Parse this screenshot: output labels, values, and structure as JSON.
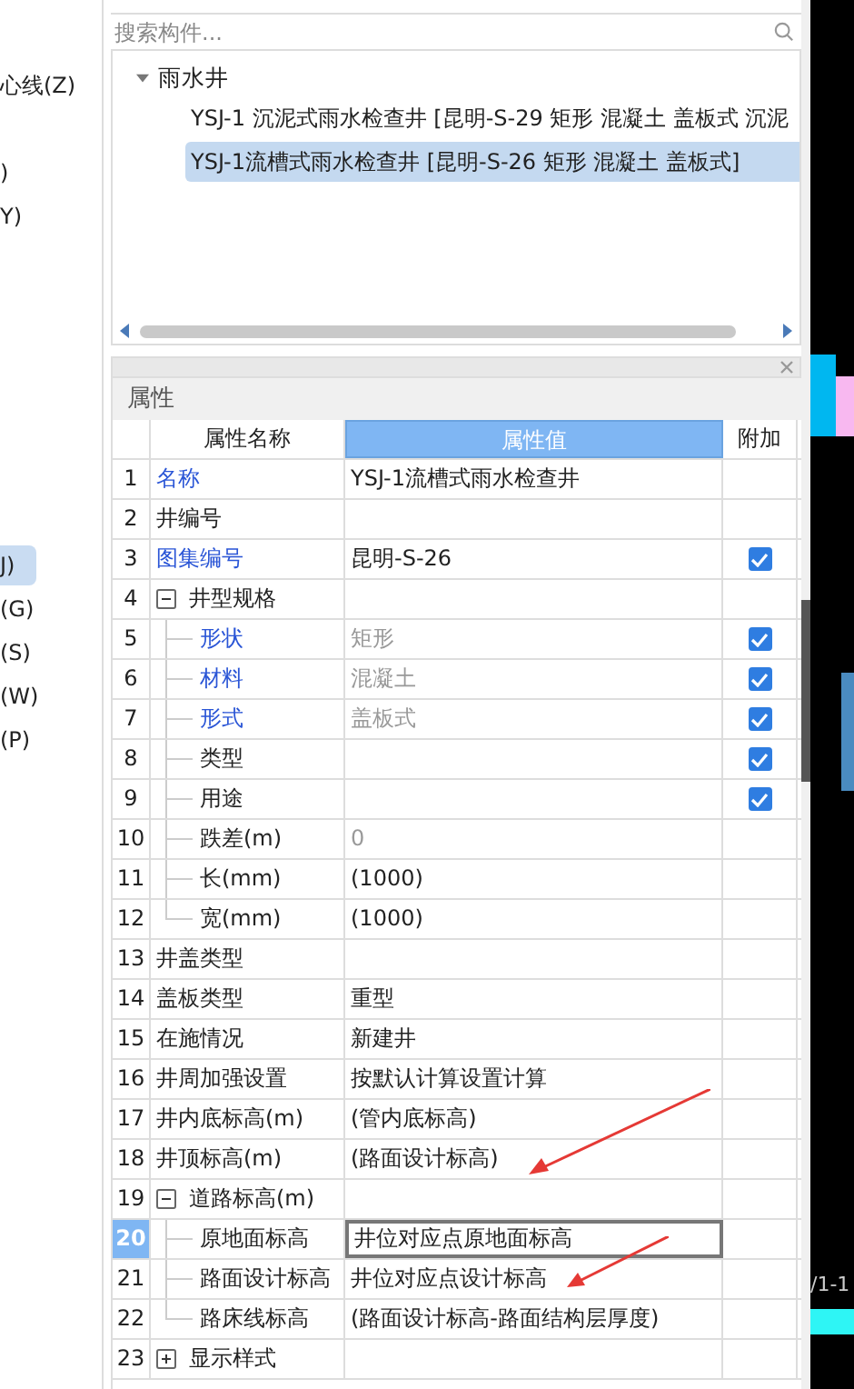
{
  "sidebar": {
    "items": [
      {
        "label": "心线(Z)",
        "selected": false
      },
      {
        "label": ")",
        "selected": false
      },
      {
        "label": "Y)",
        "selected": false
      },
      {
        "label": "J)",
        "selected": true
      },
      {
        "label": "(G)",
        "selected": false
      },
      {
        "label": "(S)",
        "selected": false
      },
      {
        "label": "(W)",
        "selected": false
      },
      {
        "label": "(P)",
        "selected": false
      }
    ]
  },
  "component_tree": {
    "search": {
      "placeholder": "搜索构件..."
    },
    "groups": [
      {
        "label": "雨水井",
        "expanded": true,
        "children": [
          {
            "label": "YSJ-1 沉泥式雨水检查井 [昆明-S-29 矩形 混凝土 盖板式 沉泥",
            "selected": false
          },
          {
            "label": "YSJ-1流槽式雨水检查井 [昆明-S-26 矩形 混凝土 盖板式]",
            "selected": true
          }
        ]
      }
    ]
  },
  "properties": {
    "title": "属性",
    "columns": [
      "属性名称",
      "属性值",
      "附加"
    ],
    "rows": [
      {
        "num": "1",
        "name": "名称",
        "value": "YSJ-1流槽式雨水检查井",
        "linked": true,
        "dimmed": false,
        "selected": false
      },
      {
        "num": "2",
        "name": "井编号",
        "linked": false,
        "dimmed": false,
        "selected": false
      },
      {
        "num": "3",
        "name": "图集编号",
        "value": "昆明-S-26",
        "linked": true,
        "dimmed": false,
        "selected": false,
        "checked": true
      },
      {
        "num": "4",
        "name": "井型规格",
        "linked": false,
        "dimmed": false,
        "selected": false,
        "expanded": true,
        "children": [
          {
            "num": "5",
            "name": "形状",
            "value": "矩形",
            "linked": true,
            "dimmed": true,
            "selected": false,
            "checked": true
          },
          {
            "num": "6",
            "name": "材料",
            "value": "混凝土",
            "linked": true,
            "dimmed": true,
            "selected": false,
            "checked": true
          },
          {
            "num": "7",
            "name": "形式",
            "value": "盖板式",
            "linked": true,
            "dimmed": true,
            "selected": false,
            "checked": true
          },
          {
            "num": "8",
            "name": "类型",
            "linked": false,
            "dimmed": false,
            "selected": false,
            "checked": true
          },
          {
            "num": "9",
            "name": "用途",
            "linked": false,
            "dimmed": false,
            "selected": false,
            "checked": true
          },
          {
            "num": "10",
            "name": "跌差(m)",
            "value": "0",
            "linked": false,
            "dimmed": true,
            "selected": false
          },
          {
            "num": "11",
            "name": "长(mm)",
            "value": "(1000)",
            "linked": false,
            "dimmed": false,
            "selected": false
          },
          {
            "num": "12",
            "name": "宽(mm)",
            "value": "(1000)",
            "linked": false,
            "dimmed": false,
            "selected": false
          }
        ]
      },
      {
        "num": "13",
        "name": "井盖类型",
        "linked": false,
        "dimmed": false,
        "selected": false
      },
      {
        "num": "14",
        "name": "盖板类型",
        "value": "重型",
        "linked": false,
        "dimmed": false,
        "selected": false
      },
      {
        "num": "15",
        "name": "在施情况",
        "value": "新建井",
        "linked": false,
        "dimmed": false,
        "selected": false
      },
      {
        "num": "16",
        "name": "井周加强设置",
        "value": "按默认计算设置计算",
        "linked": false,
        "dimmed": false,
        "selected": false
      },
      {
        "num": "17",
        "name": "井内底标高(m)",
        "value": "(管内底标高)",
        "linked": false,
        "dimmed": false,
        "selected": false
      },
      {
        "num": "18",
        "name": "井顶标高(m)",
        "value": "(路面设计标高)",
        "linked": false,
        "dimmed": false,
        "selected": false
      },
      {
        "num": "19",
        "name": "道路标高(m)",
        "linked": false,
        "dimmed": false,
        "selected": false,
        "expanded": true,
        "children": [
          {
            "num": "20",
            "name": "原地面标高",
            "value": "井位对应点原地面标高",
            "linked": false,
            "dimmed": false,
            "selected": true
          },
          {
            "num": "21",
            "name": "路面设计标高",
            "value": "井位对应点设计标高",
            "linked": false,
            "dimmed": false,
            "selected": false
          },
          {
            "num": "22",
            "name": "路床线标高",
            "value": "(路面设计标高-路面结构层厚度)",
            "linked": false,
            "dimmed": false,
            "selected": false
          }
        ]
      },
      {
        "num": "23",
        "name": "显示样式",
        "linked": false,
        "dimmed": false,
        "selected": false,
        "expanded": false
      }
    ]
  },
  "canvas": {
    "label": "/1-1"
  }
}
